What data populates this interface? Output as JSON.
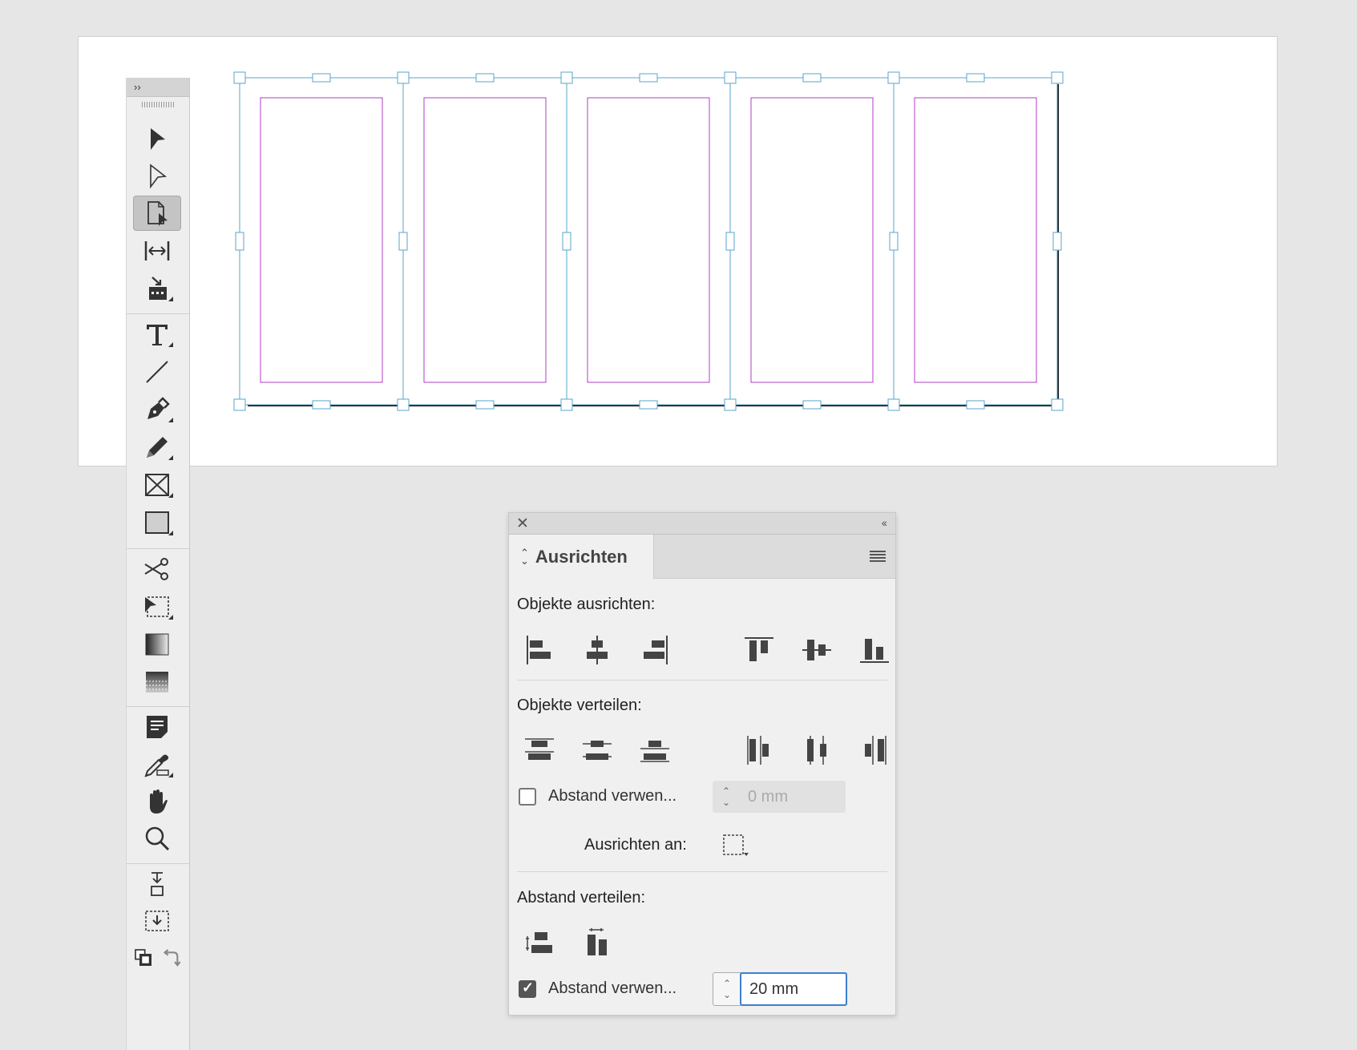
{
  "tools_panel": {
    "title": "››",
    "tools": [
      {
        "name": "selection-tool-icon"
      },
      {
        "name": "direct-selection-tool-icon"
      },
      {
        "name": "page-tool-icon",
        "active": true
      },
      {
        "name": "gap-tool-icon"
      },
      {
        "name": "content-collector-icon"
      },
      {
        "name": "type-tool-icon"
      },
      {
        "name": "line-tool-icon"
      },
      {
        "name": "pen-tool-icon"
      },
      {
        "name": "pencil-tool-icon"
      },
      {
        "name": "rectangle-frame-icon"
      },
      {
        "name": "rectangle-tool-icon"
      },
      {
        "name": "scissors-icon"
      },
      {
        "name": "free-transform-icon"
      },
      {
        "name": "gradient-swatch-icon"
      },
      {
        "name": "gradient-feather-icon"
      },
      {
        "name": "note-tool-icon"
      },
      {
        "name": "eyedropper-icon"
      },
      {
        "name": "hand-tool-icon"
      },
      {
        "name": "zoom-tool-icon"
      },
      {
        "name": "formatting-affects-container-icon"
      },
      {
        "name": "formatting-affects-text-icon"
      }
    ]
  },
  "align_panel": {
    "close": "✕",
    "collapse": "‹‹",
    "tab_title": "Ausrichten",
    "align_objects_label": "Objekte ausrichten:",
    "distribute_objects_label": "Objekte verteilen:",
    "use_spacing_label_1": "Abstand verwen...",
    "spacing_value_1": "0 mm",
    "spacing_1_checked": false,
    "align_to_label": "Ausrichten an:",
    "distribute_spacing_label": "Abstand verteilen:",
    "use_spacing_label_2": "Abstand verwen...",
    "spacing_value_2": "20 mm",
    "spacing_2_checked": true
  },
  "colors": {
    "frame_blue": "#5aa4c8",
    "margin_magenta": "#b23cc4",
    "panel_bg": "#f0f0f0",
    "focus_blue": "#3e7fd0"
  }
}
